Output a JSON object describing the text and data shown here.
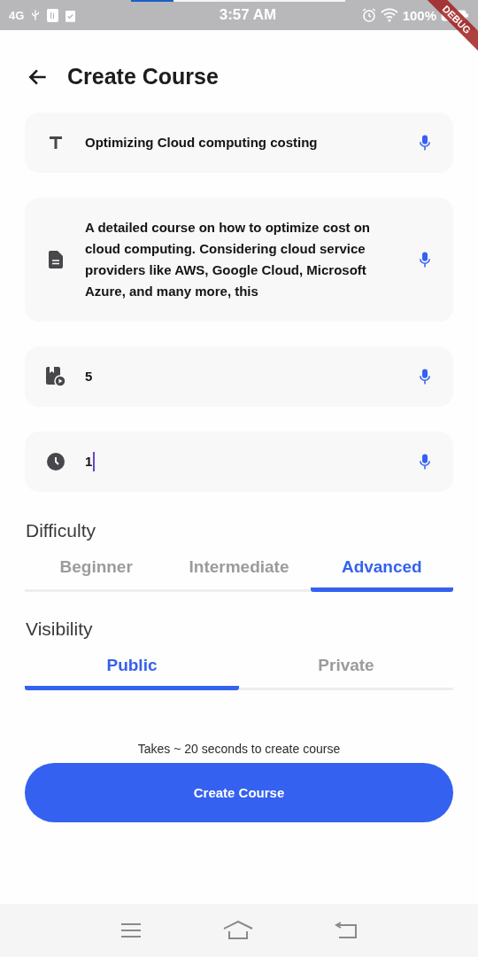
{
  "status_bar": {
    "time": "3:57 AM",
    "network": "4G",
    "battery": "100%",
    "recording": {
      "level": 0.2
    }
  },
  "debug_banner": "DEBUG",
  "header": {
    "title": "Create Course"
  },
  "fields": [
    {
      "kind": "title",
      "value": "Optimizing Cloud computing costing",
      "focused": false
    },
    {
      "kind": "description",
      "value": "A detailed course on how to optimize cost on cloud computing. Considering cloud service providers like AWS, Google Cloud, Microsoft Azure, and many more, this",
      "focused": false
    },
    {
      "kind": "lessons",
      "value": "5",
      "focused": false
    },
    {
      "kind": "duration",
      "value": "1",
      "focused": true
    }
  ],
  "difficulty": {
    "label": "Difficulty",
    "tabs": [
      {
        "label": "Beginner",
        "selected": false
      },
      {
        "label": "Intermediate",
        "selected": false
      },
      {
        "label": "Advanced",
        "selected": true
      }
    ]
  },
  "visibility": {
    "label": "Visibility",
    "tabs": [
      {
        "label": "Public",
        "selected": true
      },
      {
        "label": "Private",
        "selected": false
      }
    ]
  },
  "note": "Takes ~ 20 seconds to create course",
  "create_button": "Create Course"
}
